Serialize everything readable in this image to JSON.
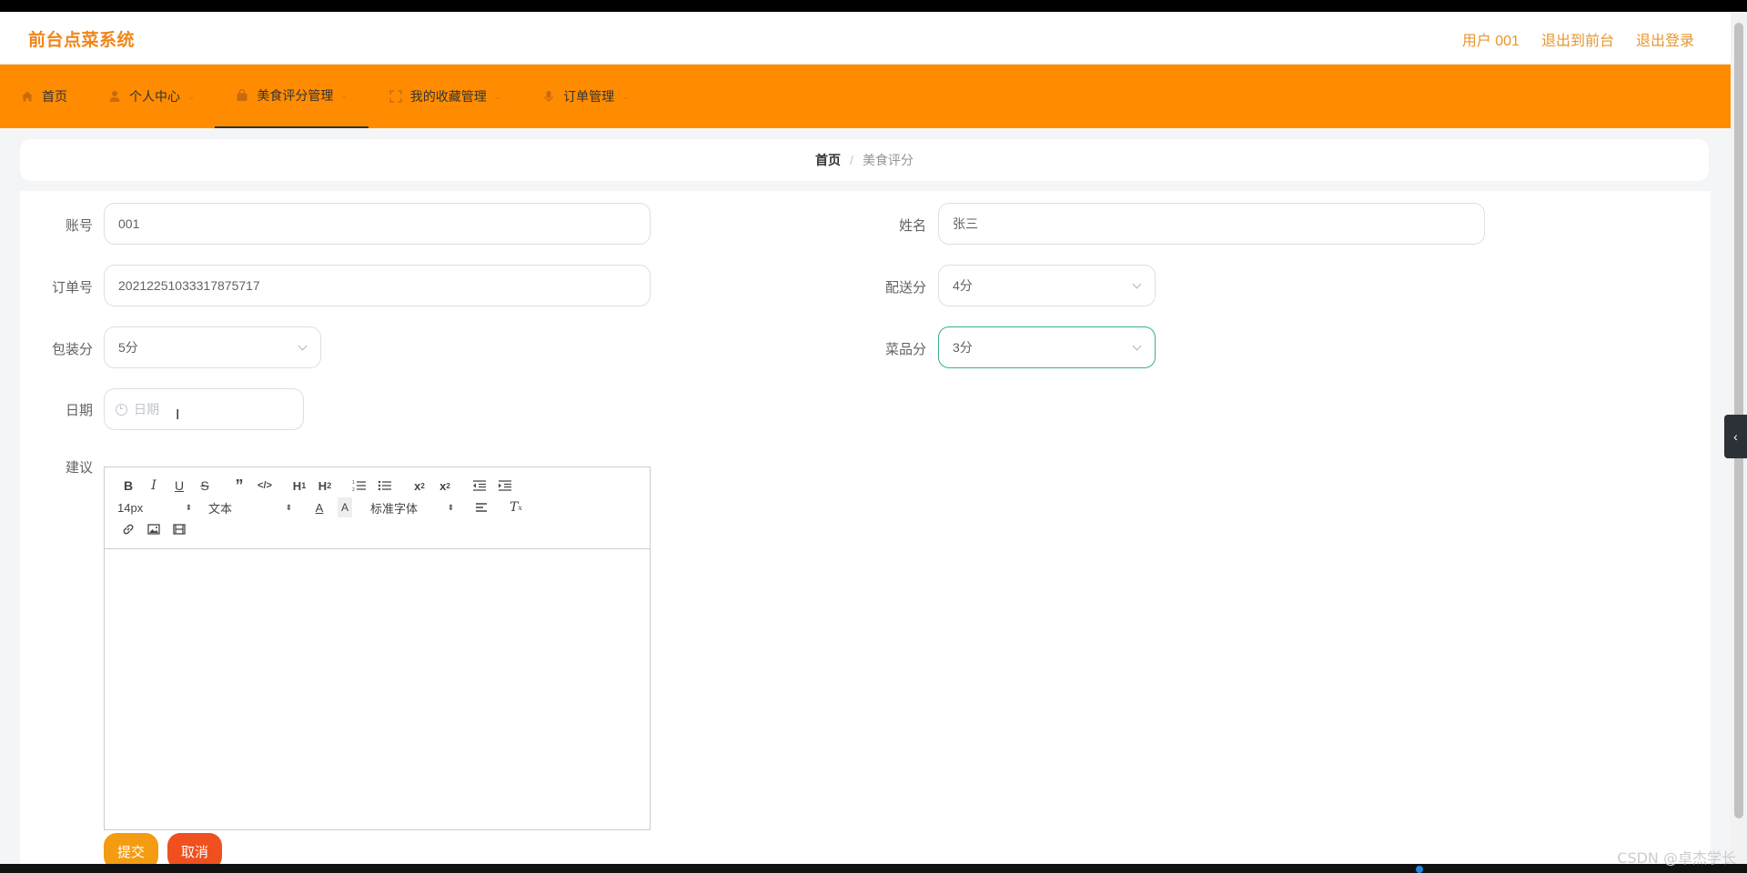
{
  "header": {
    "brand": "前台点菜系统",
    "user": "用户 001",
    "back_front": "退出到前台",
    "logout": "退出登录"
  },
  "nav": {
    "items": [
      {
        "label": "首页",
        "icon": "home-icon",
        "has_caret": false
      },
      {
        "label": "个人中心",
        "icon": "user-icon",
        "has_caret": true
      },
      {
        "label": "美食评分管理",
        "icon": "bag-icon",
        "has_caret": true,
        "active": true
      },
      {
        "label": "我的收藏管理",
        "icon": "fullscreen-icon",
        "has_caret": true
      },
      {
        "label": "订单管理",
        "icon": "mic-icon",
        "has_caret": true
      }
    ]
  },
  "breadcrumb": {
    "home": "首页",
    "separator": "/",
    "current": "美食评分"
  },
  "form": {
    "account_label": "账号",
    "account_value": "001",
    "name_label": "姓名",
    "name_value": "张三",
    "order_label": "订单号",
    "order_value": "20212251033317875717",
    "delivery_label": "配送分",
    "delivery_value": "4分",
    "package_label": "包装分",
    "package_value": "5分",
    "dish_label": "菜品分",
    "dish_value": "3分",
    "date_label": "日期",
    "date_placeholder": "日期",
    "suggestion_label": "建议"
  },
  "editor": {
    "font_size": "14px",
    "header_select": "文本",
    "font_family": "标准字体"
  },
  "buttons": {
    "submit": "提交",
    "cancel": "取消"
  },
  "colors": {
    "accent": "#ff8c00",
    "brand_text": "#f0861a",
    "submit": "#f39c12",
    "cancel": "#f0501e",
    "focus": "#36b37e"
  },
  "watermark": "CSDN @卓杰学长"
}
